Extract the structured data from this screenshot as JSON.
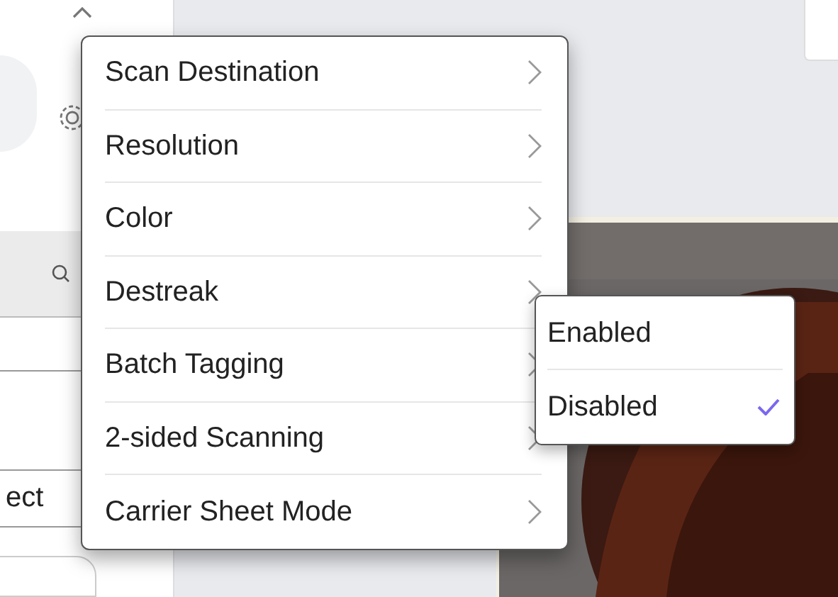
{
  "sidebar": {
    "field_text": "ect"
  },
  "menu": {
    "items": [
      {
        "label": "Scan Destination"
      },
      {
        "label": "Resolution"
      },
      {
        "label": "Color"
      },
      {
        "label": "Destreak"
      },
      {
        "label": "Batch Tagging"
      },
      {
        "label": "2-sided Scanning"
      },
      {
        "label": "Carrier Sheet Mode"
      }
    ]
  },
  "submenu": {
    "options": [
      {
        "label": "Enabled",
        "selected": false
      },
      {
        "label": "Disabled",
        "selected": true
      }
    ]
  }
}
